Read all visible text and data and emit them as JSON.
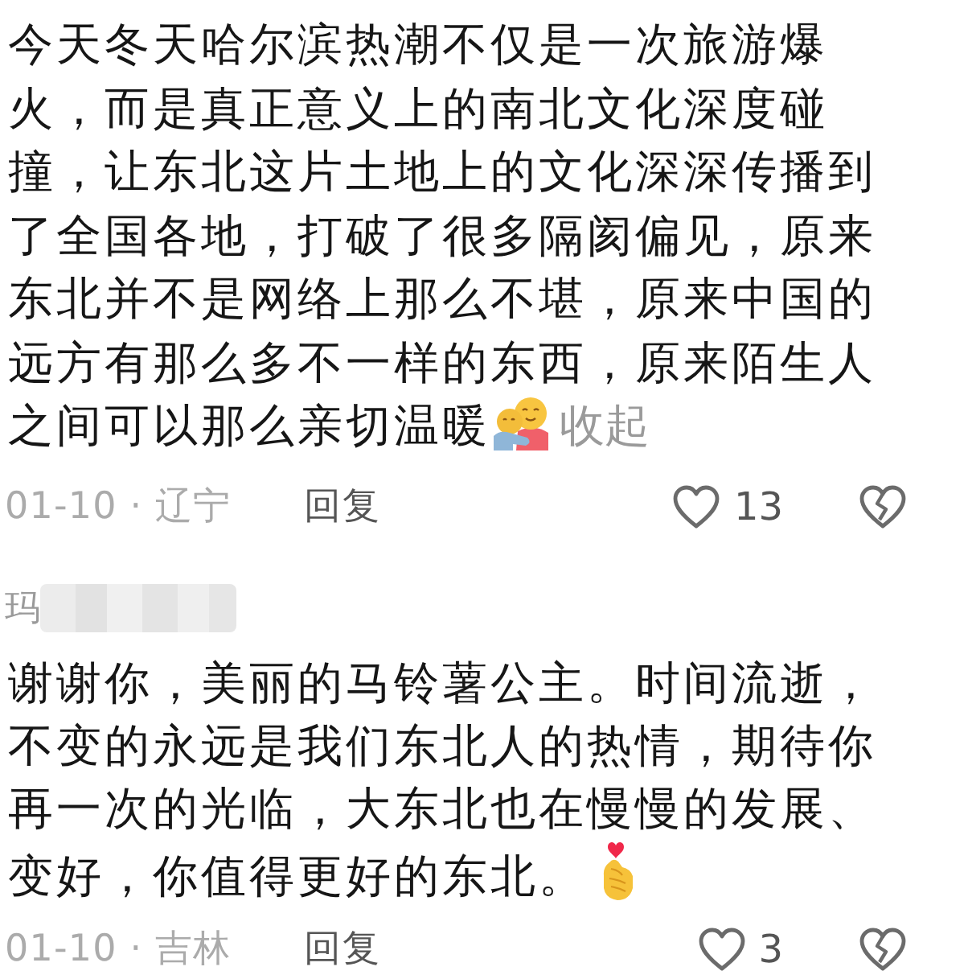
{
  "comment": {
    "text": "今天冬天哈尔滨热潮不仅是一次旅游爆火，而是真正意义上的南北文化深度碰撞，让东北这片土地上的文化深深传播到了全国各地，打破了很多隔阂偏见，原来东北并不是网络上那么不堪，原来中国的远方有那么多不一样的东西，原来陌生人之间可以那么亲切温暖",
    "collapse_link": "收起",
    "meta": "01-10 · 辽宁",
    "reply_button": "回复",
    "likes": "13",
    "liked": false,
    "disliked": false
  },
  "reply": {
    "author": "玛",
    "text": "谢谢你，美丽的马铃薯公主。时间流逝，不变的永远是我们东北人的热情，期待你再一次的光临，大东北也在慢慢的发展、变好，你值得更好的东北。",
    "meta": "01-10 · 吉林",
    "reply_button": "回复",
    "likes": "3",
    "liked": false,
    "disliked": false
  }
}
